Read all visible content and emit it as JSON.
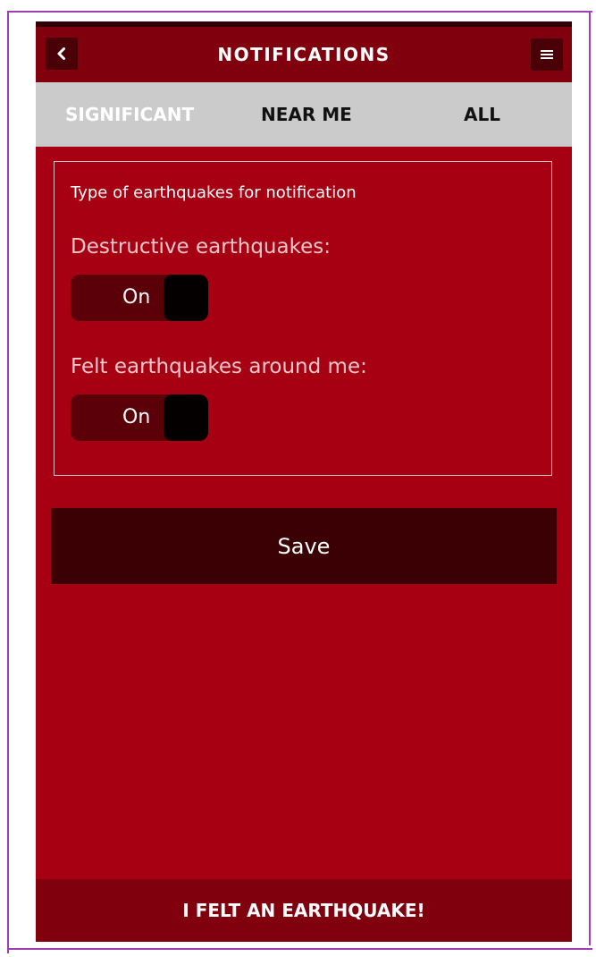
{
  "header": {
    "title": "NOTIFICATIONS",
    "back_icon": "back-arrow-icon",
    "menu_icon": "hamburger-menu-icon"
  },
  "tabs": [
    {
      "label": "SIGNIFICANT",
      "active": true
    },
    {
      "label": "NEAR ME",
      "active": false
    },
    {
      "label": "ALL",
      "active": false
    }
  ],
  "settings": {
    "heading": "Type of earthquakes for notification",
    "items": [
      {
        "label": "Destructive earthquakes:",
        "state": "On"
      },
      {
        "label": "Felt earthquakes around me:",
        "state": "On"
      }
    ]
  },
  "actions": {
    "save_label": "Save",
    "report_label": "I FELT AN EARTHQUAKE!"
  },
  "colors": {
    "primary": "#a70012",
    "header": "#80000d",
    "tabs_background": "#cbcbcb",
    "button_dark": "#3b0004",
    "frame": "#9d3fb3"
  }
}
